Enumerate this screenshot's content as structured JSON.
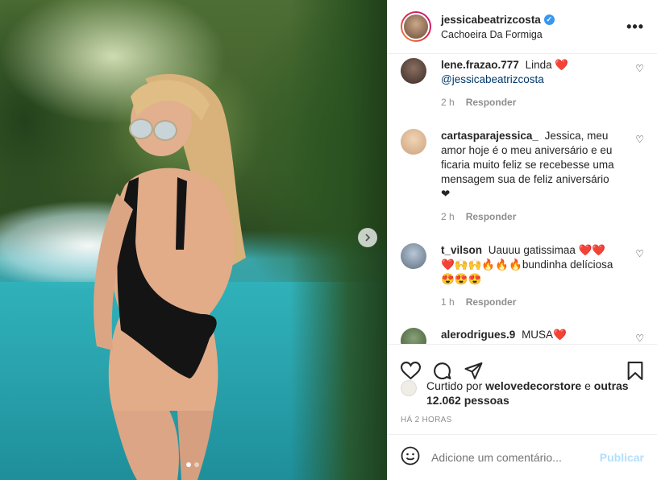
{
  "post": {
    "username": "jessicabeatrizcosta",
    "location": "Cachoeira Da Formiga",
    "more_label": "•••"
  },
  "comments": [
    {
      "user": "lene.frazao.777",
      "text": "Linda ❤️",
      "mention": "@jessicabeatrizcosta",
      "time": "2 h",
      "reply": "Responder"
    },
    {
      "user": "cartasparajessica_",
      "text": "Jessica, meu amor hoje é o meu aniversário e eu ficaria muito feliz se recebesse uma mensagem sua de feliz aniversário ❤",
      "time": "2 h",
      "reply": "Responder"
    },
    {
      "user": "t_vilson",
      "text": "Uauuu gatissimaa ❤️❤️ ❤️🙌🙌🔥🔥🔥bundinha delíciosa 😍😍😍",
      "time": "1 h",
      "reply": "Responder"
    },
    {
      "user": "alerodrigues.9",
      "text": "MUSA❤️"
    }
  ],
  "likes": {
    "prefix": "Curtido por",
    "user": "welovedecorstore",
    "joiner": "e",
    "others": "outras 12.062 pessoas"
  },
  "timestamp": "HÁ 2 HORAS",
  "comment_box": {
    "placeholder": "Adicione um comentário...",
    "publish_label": "Publicar"
  },
  "colors": {
    "verified": "#3897f0",
    "heart": "#ed4956",
    "link": "#00376b",
    "publish_disabled": "#b2dffc"
  },
  "icons": [
    "verified-badge-icon",
    "more-options-icon",
    "comment-heart-icon",
    "like-icon",
    "comment-icon",
    "share-icon",
    "save-icon",
    "emoji-icon",
    "next-arrow-icon"
  ]
}
